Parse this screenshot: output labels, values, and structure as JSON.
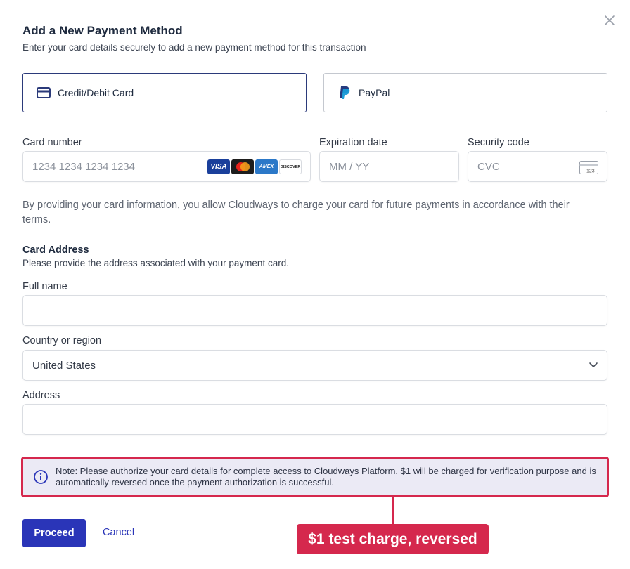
{
  "dialog": {
    "title": "Add a New Payment Method",
    "subtitle": "Enter your card details securely to add a new payment method for this transaction",
    "close_icon": "close-icon"
  },
  "methods": [
    {
      "label": "Credit/Debit Card",
      "icon": "credit-card-icon",
      "selected": true
    },
    {
      "label": "PayPal",
      "icon": "paypal-icon",
      "selected": false
    }
  ],
  "card": {
    "number_label": "Card number",
    "number_placeholder": "1234 1234 1234 1234",
    "brands": [
      "VISA",
      "mastercard",
      "AMEX",
      "DISCOVER"
    ],
    "expiry_label": "Expiration date",
    "expiry_placeholder": "MM / YY",
    "cvc_label": "Security code",
    "cvc_placeholder": "CVC",
    "cvc_icon_text": "123",
    "consent": "By providing your card information, you allow Cloudways to charge your card for future payments in accordance with their terms."
  },
  "address": {
    "heading": "Card Address",
    "description": "Please provide the address associated with your payment card.",
    "fullname_label": "Full name",
    "fullname_value": "",
    "country_label": "Country or region",
    "country_value": "United States",
    "address_label": "Address",
    "address_value": ""
  },
  "notice": {
    "text": "Note: Please authorize your card details for complete access to Cloudways Platform. $1 will be charged for verification purpose and is automatically reversed once the payment authorization is successful.",
    "icon": "info-icon"
  },
  "actions": {
    "proceed_label": "Proceed",
    "cancel_label": "Cancel"
  },
  "callout": {
    "text": "$1 test charge, reversed"
  },
  "colors": {
    "primary": "#2a35b8",
    "highlight": "#d5284d",
    "notice_bg": "#ebeaf5"
  }
}
